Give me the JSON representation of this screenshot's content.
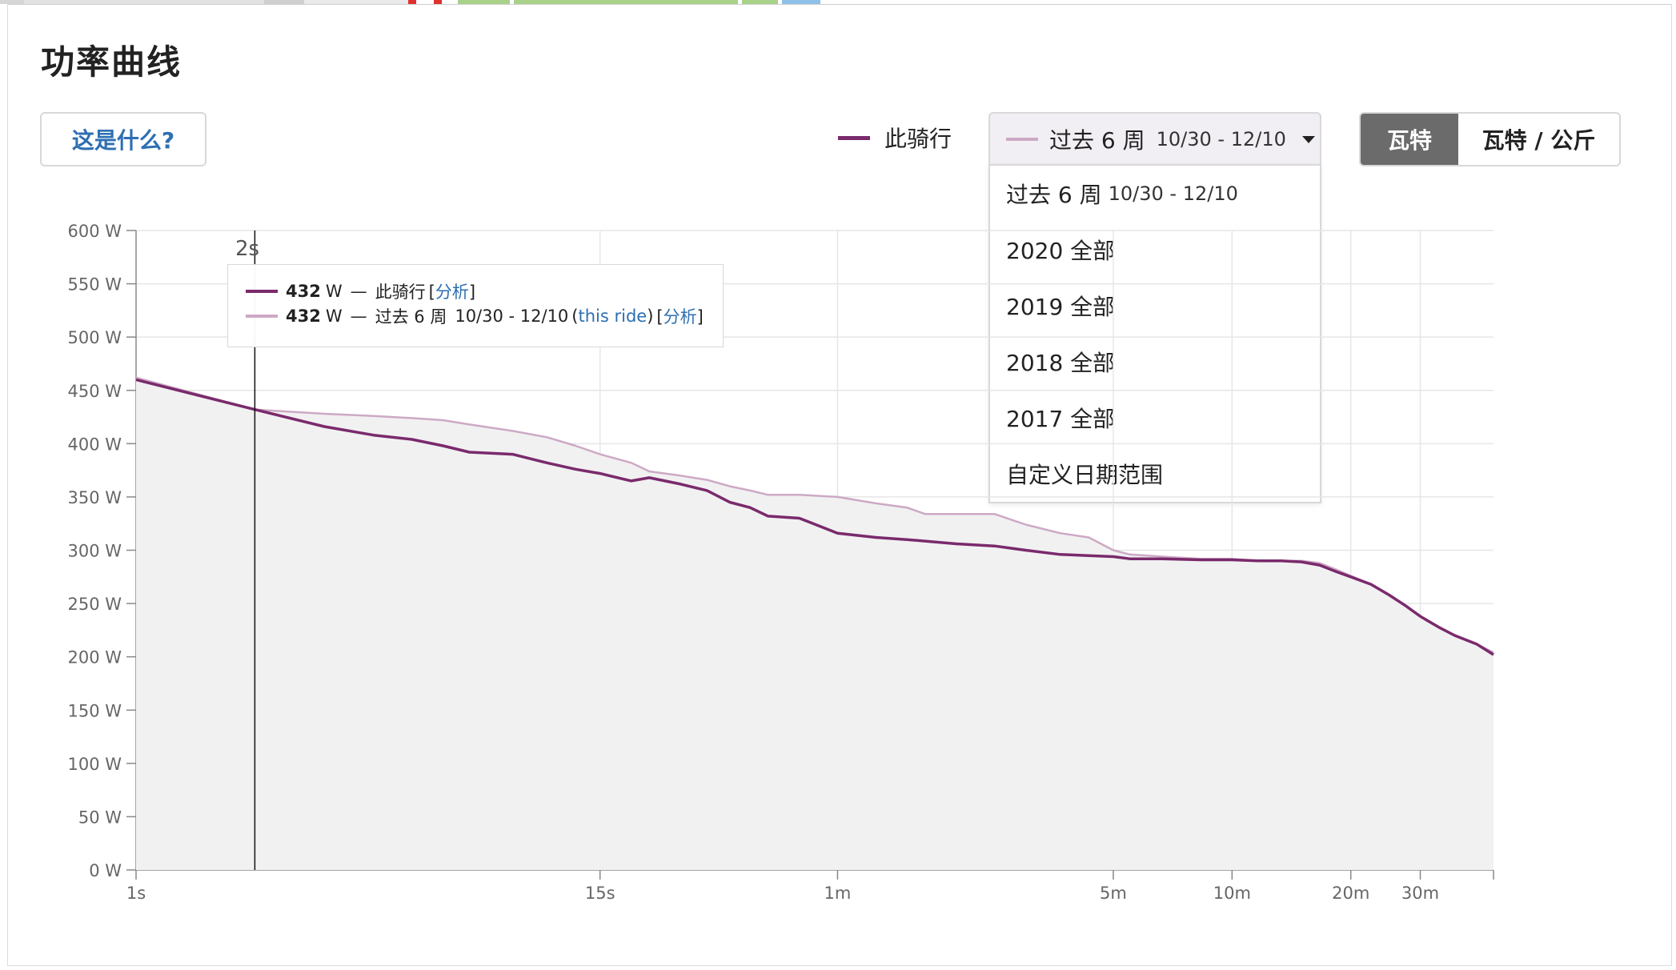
{
  "title": "功率曲线",
  "what_button": "这是什么?",
  "legend": {
    "this_ride": "此骑行",
    "this_ride_color": "#7a2a6c",
    "past_color": "#cda9c5"
  },
  "range_select": {
    "label": "过去 6 周",
    "dates": "10/30 - 12/10"
  },
  "range_options": [
    {
      "label": "过去 6 周",
      "dates": "10/30 - 12/10"
    },
    {
      "label": "2020 全部",
      "dates": ""
    },
    {
      "label": "2019 全部",
      "dates": ""
    },
    {
      "label": "2018 全部",
      "dates": ""
    },
    {
      "label": "2017 全部",
      "dates": ""
    },
    {
      "label": "自定义日期范围",
      "dates": ""
    }
  ],
  "units": {
    "watts": "瓦特",
    "wkg": "瓦特 / 公斤"
  },
  "tooltip": {
    "hover_time": "2s",
    "row1": {
      "value": "432",
      "unit": "W",
      "dash": "—",
      "name": "此骑行",
      "link": "分析"
    },
    "row2": {
      "value": "432",
      "unit": "W",
      "dash": "—",
      "name": "过去 6 周",
      "dates": "10/30 - 12/10",
      "this_ride": "this ride",
      "link": "分析"
    }
  },
  "chart_data": {
    "type": "area",
    "y_unit": "W",
    "ylim": [
      0,
      600
    ],
    "y_ticks": [
      "0 W",
      "50 W",
      "100 W",
      "150 W",
      "200 W",
      "250 W",
      "300 W",
      "350 W",
      "400 W",
      "450 W",
      "500 W",
      "550 W",
      "600 W"
    ],
    "x_ticks": [
      {
        "label": "1s",
        "seconds": 1
      },
      {
        "label": "15s",
        "seconds": 15
      },
      {
        "label": "1m",
        "seconds": 60
      },
      {
        "label": "5m",
        "seconds": 300
      },
      {
        "label": "10m",
        "seconds": 600
      },
      {
        "label": "20m",
        "seconds": 1200
      },
      {
        "label": "30m",
        "seconds": 1800
      }
    ],
    "xlim_seconds": [
      1,
      2760
    ],
    "series": [
      {
        "name": "此骑行",
        "color": "#7a2a6c",
        "points": [
          [
            1,
            460
          ],
          [
            2,
            432
          ],
          [
            3,
            416
          ],
          [
            4,
            408
          ],
          [
            5,
            404
          ],
          [
            6,
            398
          ],
          [
            7,
            392
          ],
          [
            9,
            390
          ],
          [
            11,
            382
          ],
          [
            13,
            376
          ],
          [
            15,
            372
          ],
          [
            18,
            365
          ],
          [
            20,
            368
          ],
          [
            24,
            362
          ],
          [
            28,
            356
          ],
          [
            32,
            345
          ],
          [
            36,
            340
          ],
          [
            40,
            332
          ],
          [
            48,
            330
          ],
          [
            60,
            316
          ],
          [
            75,
            312
          ],
          [
            90,
            310
          ],
          [
            120,
            306
          ],
          [
            150,
            304
          ],
          [
            180,
            300
          ],
          [
            220,
            296
          ],
          [
            260,
            295
          ],
          [
            300,
            294
          ],
          [
            330,
            292
          ],
          [
            400,
            292
          ],
          [
            500,
            291
          ],
          [
            600,
            291
          ],
          [
            700,
            290
          ],
          [
            800,
            290
          ],
          [
            900,
            289
          ],
          [
            1000,
            286
          ],
          [
            1100,
            280
          ],
          [
            1200,
            275
          ],
          [
            1350,
            268
          ],
          [
            1500,
            258
          ],
          [
            1650,
            248
          ],
          [
            1800,
            238
          ],
          [
            2000,
            228
          ],
          [
            2200,
            220
          ],
          [
            2500,
            212
          ],
          [
            2760,
            202
          ]
        ]
      },
      {
        "name": "过去 6 周",
        "color": "#cda9c5",
        "points": [
          [
            1,
            462
          ],
          [
            2,
            432
          ],
          [
            3,
            428
          ],
          [
            4,
            426
          ],
          [
            5,
            424
          ],
          [
            6,
            422
          ],
          [
            7,
            418
          ],
          [
            9,
            412
          ],
          [
            11,
            406
          ],
          [
            13,
            398
          ],
          [
            15,
            390
          ],
          [
            18,
            382
          ],
          [
            20,
            374
          ],
          [
            24,
            370
          ],
          [
            28,
            366
          ],
          [
            32,
            360
          ],
          [
            36,
            356
          ],
          [
            40,
            352
          ],
          [
            48,
            352
          ],
          [
            60,
            350
          ],
          [
            75,
            344
          ],
          [
            90,
            340
          ],
          [
            100,
            334
          ],
          [
            120,
            334
          ],
          [
            150,
            334
          ],
          [
            180,
            324
          ],
          [
            220,
            316
          ],
          [
            260,
            312
          ],
          [
            300,
            300
          ],
          [
            330,
            296
          ],
          [
            400,
            294
          ],
          [
            500,
            292
          ],
          [
            600,
            292
          ],
          [
            700,
            290
          ],
          [
            800,
            290
          ],
          [
            900,
            290
          ],
          [
            1000,
            288
          ],
          [
            1100,
            282
          ],
          [
            1200,
            276
          ],
          [
            1350,
            268
          ],
          [
            1500,
            258
          ],
          [
            1650,
            248
          ],
          [
            1800,
            238
          ],
          [
            2000,
            228
          ],
          [
            2200,
            220
          ],
          [
            2500,
            212
          ],
          [
            2760,
            204
          ]
        ]
      }
    ],
    "hover_seconds": 2,
    "grid": true
  }
}
